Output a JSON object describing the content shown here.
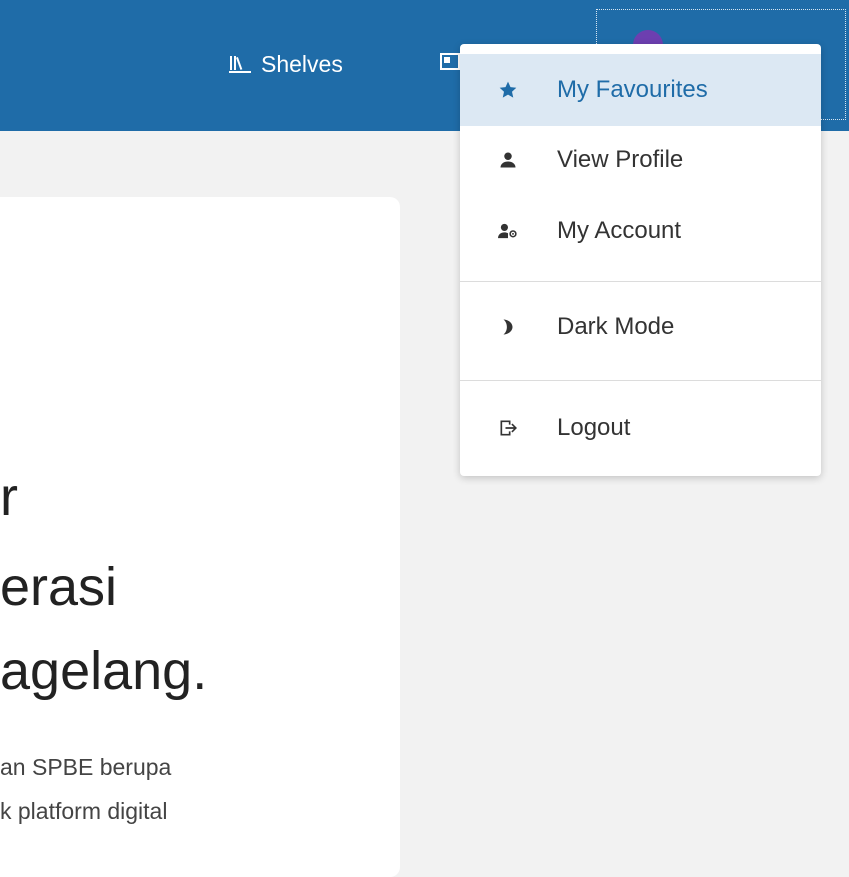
{
  "header": {
    "nav": {
      "shelves_label": "Shelves"
    }
  },
  "user_menu": {
    "items": [
      {
        "label": "My Favourites",
        "icon": "star-icon"
      },
      {
        "label": "View Profile",
        "icon": "user-icon"
      },
      {
        "label": "My Account",
        "icon": "user-settings-icon"
      },
      {
        "label": "Dark Mode",
        "icon": "moon-icon"
      },
      {
        "label": "Logout",
        "icon": "logout-icon"
      }
    ]
  },
  "hero": {
    "lines": [
      "r",
      "erasi",
      "agelang."
    ],
    "body_lines": [
      "an SPBE berupa",
      "k platform digital"
    ]
  },
  "colors": {
    "header_bg": "#1f6ca8",
    "accent": "#1f6ca8",
    "active_item_bg": "#dce8f3",
    "page_bg": "#f2f2f2"
  }
}
